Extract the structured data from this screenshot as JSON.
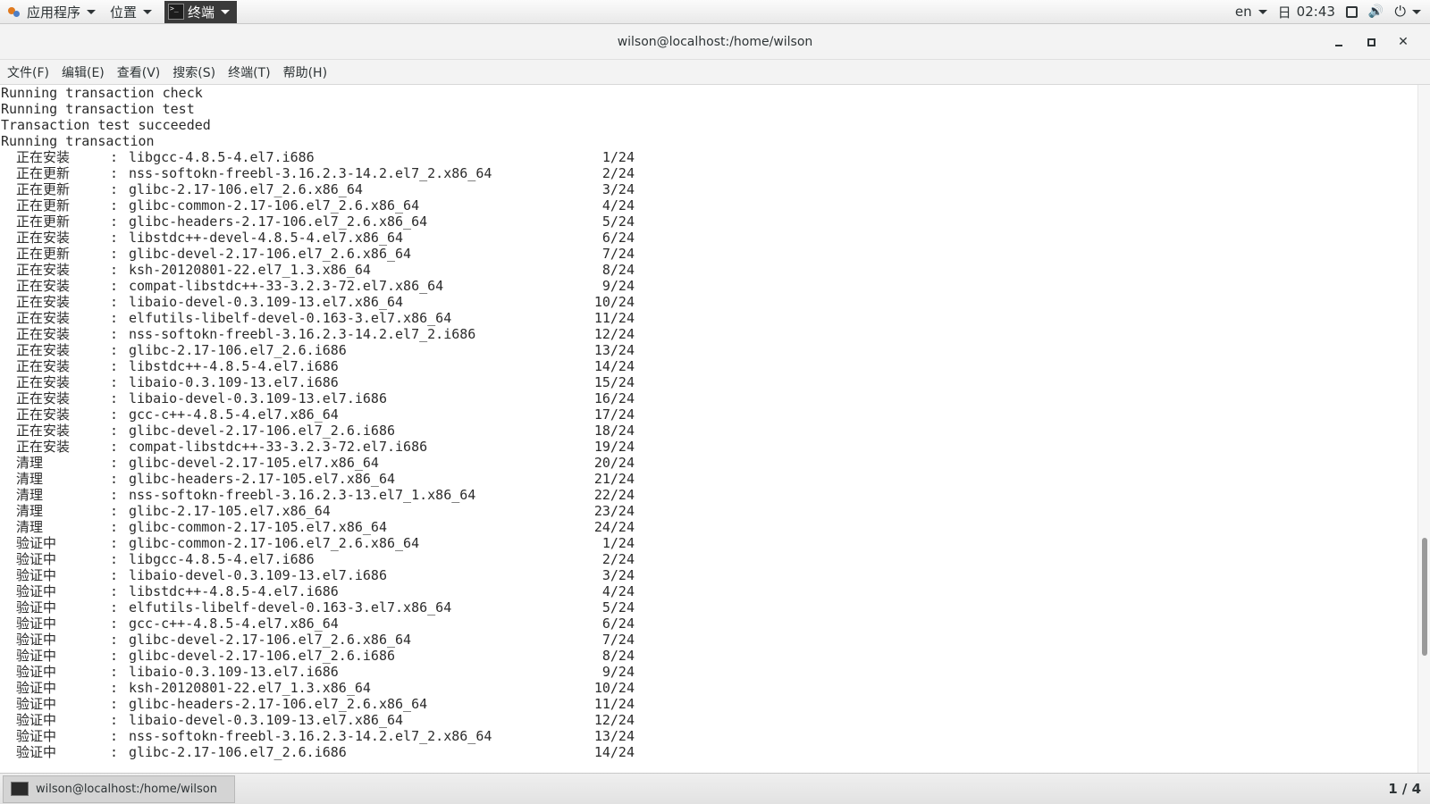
{
  "top_panel": {
    "apps_label": "应用程序",
    "places_label": "位置",
    "terminal_label": "终端",
    "lang": "en",
    "day": "日",
    "time": "02:43"
  },
  "window": {
    "title": "wilson@localhost:/home/wilson"
  },
  "menu": {
    "file": "文件(F)",
    "edit": "编辑(E)",
    "view": "查看(V)",
    "search": "搜索(S)",
    "terminal": "终端(T)",
    "help": "帮助(H)"
  },
  "terminal": {
    "plain_lines": [
      "Running transaction check",
      "Running transaction test",
      "Transaction test succeeded",
      "Running transaction"
    ],
    "rows": [
      {
        "action": "正在安装",
        "pkg": "libgcc-4.8.5-4.el7.i686",
        "prog": "1/24"
      },
      {
        "action": "正在更新",
        "pkg": "nss-softokn-freebl-3.16.2.3-14.2.el7_2.x86_64",
        "prog": "2/24"
      },
      {
        "action": "正在更新",
        "pkg": "glibc-2.17-106.el7_2.6.x86_64",
        "prog": "3/24"
      },
      {
        "action": "正在更新",
        "pkg": "glibc-common-2.17-106.el7_2.6.x86_64",
        "prog": "4/24"
      },
      {
        "action": "正在更新",
        "pkg": "glibc-headers-2.17-106.el7_2.6.x86_64",
        "prog": "5/24"
      },
      {
        "action": "正在安装",
        "pkg": "libstdc++-devel-4.8.5-4.el7.x86_64",
        "prog": "6/24"
      },
      {
        "action": "正在更新",
        "pkg": "glibc-devel-2.17-106.el7_2.6.x86_64",
        "prog": "7/24"
      },
      {
        "action": "正在安装",
        "pkg": "ksh-20120801-22.el7_1.3.x86_64",
        "prog": "8/24"
      },
      {
        "action": "正在安装",
        "pkg": "compat-libstdc++-33-3.2.3-72.el7.x86_64",
        "prog": "9/24"
      },
      {
        "action": "正在安装",
        "pkg": "libaio-devel-0.3.109-13.el7.x86_64",
        "prog": "10/24"
      },
      {
        "action": "正在安装",
        "pkg": "elfutils-libelf-devel-0.163-3.el7.x86_64",
        "prog": "11/24"
      },
      {
        "action": "正在安装",
        "pkg": "nss-softokn-freebl-3.16.2.3-14.2.el7_2.i686",
        "prog": "12/24"
      },
      {
        "action": "正在安装",
        "pkg": "glibc-2.17-106.el7_2.6.i686",
        "prog": "13/24"
      },
      {
        "action": "正在安装",
        "pkg": "libstdc++-4.8.5-4.el7.i686",
        "prog": "14/24"
      },
      {
        "action": "正在安装",
        "pkg": "libaio-0.3.109-13.el7.i686",
        "prog": "15/24"
      },
      {
        "action": "正在安装",
        "pkg": "libaio-devel-0.3.109-13.el7.i686",
        "prog": "16/24"
      },
      {
        "action": "正在安装",
        "pkg": "gcc-c++-4.8.5-4.el7.x86_64",
        "prog": "17/24"
      },
      {
        "action": "正在安装",
        "pkg": "glibc-devel-2.17-106.el7_2.6.i686",
        "prog": "18/24"
      },
      {
        "action": "正在安装",
        "pkg": "compat-libstdc++-33-3.2.3-72.el7.i686",
        "prog": "19/24"
      },
      {
        "action": "清理",
        "pkg": "glibc-devel-2.17-105.el7.x86_64",
        "prog": "20/24"
      },
      {
        "action": "清理",
        "pkg": "glibc-headers-2.17-105.el7.x86_64",
        "prog": "21/24"
      },
      {
        "action": "清理",
        "pkg": "nss-softokn-freebl-3.16.2.3-13.el7_1.x86_64",
        "prog": "22/24"
      },
      {
        "action": "清理",
        "pkg": "glibc-2.17-105.el7.x86_64",
        "prog": "23/24"
      },
      {
        "action": "清理",
        "pkg": "glibc-common-2.17-105.el7.x86_64",
        "prog": "24/24"
      },
      {
        "action": "验证中",
        "pkg": "glibc-common-2.17-106.el7_2.6.x86_64",
        "prog": "1/24"
      },
      {
        "action": "验证中",
        "pkg": "libgcc-4.8.5-4.el7.i686",
        "prog": "2/24"
      },
      {
        "action": "验证中",
        "pkg": "libaio-devel-0.3.109-13.el7.i686",
        "prog": "3/24"
      },
      {
        "action": "验证中",
        "pkg": "libstdc++-4.8.5-4.el7.i686",
        "prog": "4/24"
      },
      {
        "action": "验证中",
        "pkg": "elfutils-libelf-devel-0.163-3.el7.x86_64",
        "prog": "5/24"
      },
      {
        "action": "验证中",
        "pkg": "gcc-c++-4.8.5-4.el7.x86_64",
        "prog": "6/24"
      },
      {
        "action": "验证中",
        "pkg": "glibc-devel-2.17-106.el7_2.6.x86_64",
        "prog": "7/24"
      },
      {
        "action": "验证中",
        "pkg": "glibc-devel-2.17-106.el7_2.6.i686",
        "prog": "8/24"
      },
      {
        "action": "验证中",
        "pkg": "libaio-0.3.109-13.el7.i686",
        "prog": "9/24"
      },
      {
        "action": "验证中",
        "pkg": "ksh-20120801-22.el7_1.3.x86_64",
        "prog": "10/24"
      },
      {
        "action": "验证中",
        "pkg": "glibc-headers-2.17-106.el7_2.6.x86_64",
        "prog": "11/24"
      },
      {
        "action": "验证中",
        "pkg": "libaio-devel-0.3.109-13.el7.x86_64",
        "prog": "12/24"
      },
      {
        "action": "验证中",
        "pkg": "nss-softokn-freebl-3.16.2.3-14.2.el7_2.x86_64",
        "prog": "13/24"
      },
      {
        "action": "验证中",
        "pkg": "glibc-2.17-106.el7_2.6.i686",
        "prog": "14/24"
      }
    ]
  },
  "taskbar": {
    "task_label": "wilson@localhost:/home/wilson",
    "workspace": "1 / 4"
  }
}
